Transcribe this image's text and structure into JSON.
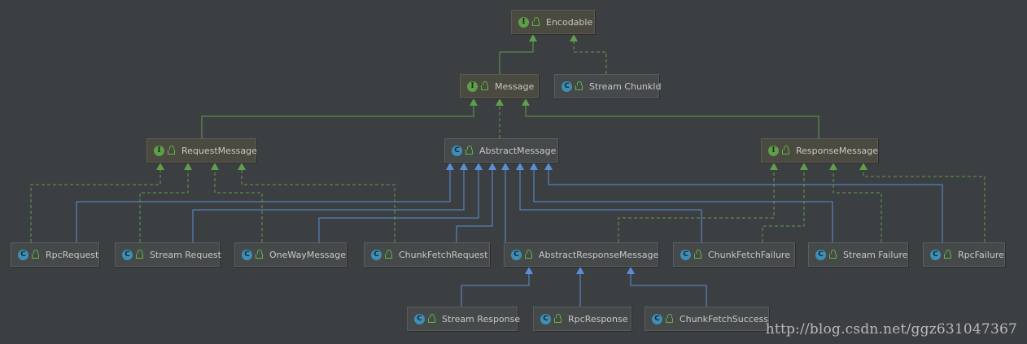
{
  "diagram": {
    "nodes": [
      {
        "id": "Encodable",
        "kind": "interface",
        "label": "Encodable"
      },
      {
        "id": "Message",
        "kind": "interface",
        "label": "Message"
      },
      {
        "id": "StreamChunkId",
        "kind": "class",
        "label": "Stream ChunkId"
      },
      {
        "id": "RequestMessage",
        "kind": "interface",
        "label": "RequestMessage"
      },
      {
        "id": "AbstractMessage",
        "kind": "class",
        "label": "AbstractMessage"
      },
      {
        "id": "ResponseMessage",
        "kind": "interface",
        "label": "ResponseMessage"
      },
      {
        "id": "RpcRequest",
        "kind": "class",
        "label": "RpcRequest"
      },
      {
        "id": "StreamRequest",
        "kind": "class",
        "label": "Stream Request"
      },
      {
        "id": "OneWayMessage",
        "kind": "class",
        "label": "OneWayMessage"
      },
      {
        "id": "ChunkFetchRequest",
        "kind": "class",
        "label": "ChunkFetchRequest"
      },
      {
        "id": "AbstractResponseMessage",
        "kind": "class",
        "label": "AbstractResponseMessage"
      },
      {
        "id": "ChunkFetchFailure",
        "kind": "class",
        "label": "ChunkFetchFailure"
      },
      {
        "id": "StreamFailure",
        "kind": "class",
        "label": "Stream Failure"
      },
      {
        "id": "RpcFailure",
        "kind": "class",
        "label": "RpcFailure"
      },
      {
        "id": "StreamResponse",
        "kind": "class",
        "label": "Stream Response"
      },
      {
        "id": "RpcResponse",
        "kind": "class",
        "label": "RpcResponse"
      },
      {
        "id": "ChunkFetchSuccess",
        "kind": "class",
        "label": "ChunkFetchSuccess"
      }
    ],
    "edges": [
      {
        "from": "Message",
        "to": "Encodable",
        "type": "extends"
      },
      {
        "from": "StreamChunkId",
        "to": "Encodable",
        "type": "implements"
      },
      {
        "from": "RequestMessage",
        "to": "Message",
        "type": "extends"
      },
      {
        "from": "AbstractMessage",
        "to": "Message",
        "type": "implements"
      },
      {
        "from": "ResponseMessage",
        "to": "Message",
        "type": "extends"
      },
      {
        "from": "RpcRequest",
        "to": "AbstractMessage",
        "type": "extends"
      },
      {
        "from": "RpcRequest",
        "to": "RequestMessage",
        "type": "implements"
      },
      {
        "from": "StreamRequest",
        "to": "AbstractMessage",
        "type": "extends"
      },
      {
        "from": "StreamRequest",
        "to": "RequestMessage",
        "type": "implements"
      },
      {
        "from": "OneWayMessage",
        "to": "AbstractMessage",
        "type": "extends"
      },
      {
        "from": "OneWayMessage",
        "to": "RequestMessage",
        "type": "implements"
      },
      {
        "from": "ChunkFetchRequest",
        "to": "AbstractMessage",
        "type": "extends"
      },
      {
        "from": "ChunkFetchRequest",
        "to": "RequestMessage",
        "type": "implements"
      },
      {
        "from": "AbstractResponseMessage",
        "to": "AbstractMessage",
        "type": "extends"
      },
      {
        "from": "AbstractResponseMessage",
        "to": "ResponseMessage",
        "type": "implements"
      },
      {
        "from": "ChunkFetchFailure",
        "to": "AbstractMessage",
        "type": "extends"
      },
      {
        "from": "ChunkFetchFailure",
        "to": "ResponseMessage",
        "type": "implements"
      },
      {
        "from": "StreamFailure",
        "to": "AbstractMessage",
        "type": "extends"
      },
      {
        "from": "StreamFailure",
        "to": "ResponseMessage",
        "type": "implements"
      },
      {
        "from": "RpcFailure",
        "to": "AbstractMessage",
        "type": "extends"
      },
      {
        "from": "RpcFailure",
        "to": "ResponseMessage",
        "type": "implements"
      },
      {
        "from": "StreamResponse",
        "to": "AbstractResponseMessage",
        "type": "extends"
      },
      {
        "from": "RpcResponse",
        "to": "AbstractResponseMessage",
        "type": "extends"
      },
      {
        "from": "ChunkFetchSuccess",
        "to": "AbstractResponseMessage",
        "type": "extends"
      }
    ],
    "badges": {
      "interface": "I",
      "class": "C"
    },
    "colors": {
      "background": "#3c3f41",
      "interface_extends": "#5f9e4a",
      "implements": "#5f9e4a",
      "class_extends": "#5a8fd8"
    }
  },
  "watermark": "http://blog.csdn.net/ggz631047367"
}
